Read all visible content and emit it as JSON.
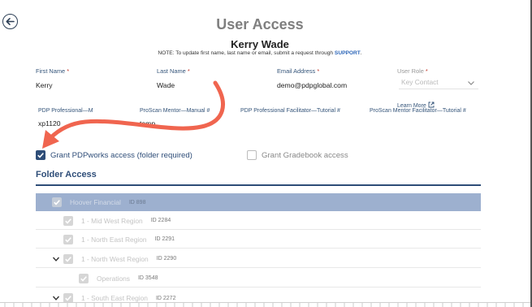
{
  "page": {
    "title": "User Access",
    "user_name": "Kerry Wade",
    "note_prefix": "NOTE: To update first name, last name or email, submit a request through ",
    "note_link": "SUPPORT",
    "note_suffix": "."
  },
  "fields": {
    "first_name": {
      "label": "First Name",
      "value": "Kerry"
    },
    "last_name": {
      "label": "Last Name",
      "value": "Wade"
    },
    "email": {
      "label": "Email Address",
      "value": "demo@pdpglobal.com"
    },
    "role": {
      "label": "User Role",
      "placeholder": "Key Contact"
    }
  },
  "manuals": {
    "pdp_professional": {
      "label": "PDP Professional—M",
      "value": "xp1120"
    },
    "proscan_mentor": {
      "label": "ProScan Mentor—Manual #",
      "value": "temp"
    },
    "pdp_facilitator": {
      "label": "PDP Professional Facilitator—Tutorial #"
    },
    "proscan_facilitator": {
      "label": "ProScan Mentor Facilitator—Tutorial #"
    },
    "learn_more": "Learn More"
  },
  "access": {
    "pdpworks": {
      "label": "Grant PDPworks access (folder required)",
      "checked": true
    },
    "gradebook": {
      "label": "Grant Gradebook access",
      "checked": false
    }
  },
  "folder_access": {
    "title": "Folder Access",
    "rows": [
      {
        "name": "Hoover Financial",
        "id": "ID 898"
      },
      {
        "name": "1 - Mid West Region",
        "id": "ID 2284"
      },
      {
        "name": "1 - North East Region",
        "id": "ID 2291"
      },
      {
        "name": "1 - North West Region",
        "id": "ID 2290"
      },
      {
        "name": "Operations",
        "id": "ID 3548"
      },
      {
        "name": "1 - South East Region",
        "id": "ID 2272"
      }
    ]
  },
  "colors": {
    "accent": "#2e4d78",
    "selected_row": "#9db0cf",
    "annotation_arrow": "#f0654f"
  },
  "icons": [
    "back-arrow-icon",
    "chevron-down-icon",
    "external-link-icon",
    "checkmark-icon",
    "annotation-arrow"
  ]
}
